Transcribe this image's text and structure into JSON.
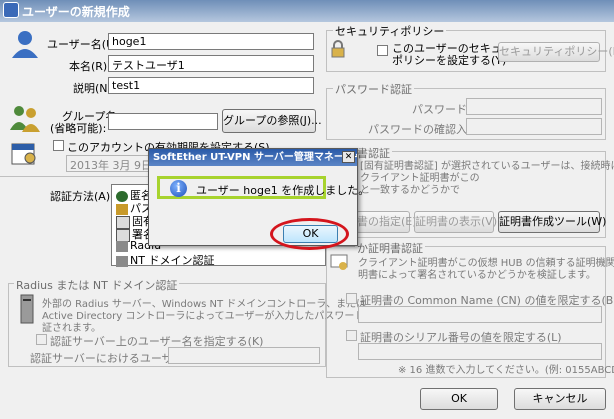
{
  "window": {
    "title": "ユーザーの新規作成"
  },
  "user": {
    "username_label": "ユーザー名(U):",
    "username_value": "hoge1",
    "realname_label": "本名(R):",
    "realname_value": "テストユーザ1",
    "desc_label": "説明(N):",
    "desc_value": "test1"
  },
  "group": {
    "name_label_line1": "グループ名",
    "name_label_line2": "(省略可能):",
    "name_value": "",
    "browse_button": "グループの参照(J)..."
  },
  "expiry": {
    "checkbox_label": "このアカウントの有効期限を設定する(S)",
    "date_value": "2013年 3月 9日"
  },
  "security": {
    "group_label": "セキュリティポリシー",
    "checkbox_line1": "このユーザーのセキュリティ",
    "checkbox_line2": "ポリシーを設定する(Y)",
    "button": "セキュリティポリシー(M)"
  },
  "password": {
    "group_label": "パスワード認証",
    "password_label": "パスワード(P):",
    "confirm_label": "パスワードの確認入力(C):"
  },
  "auth": {
    "label": "認証方法(A):",
    "items": [
      {
        "label": "匿名",
        "icon": "anonymous-icon",
        "color": "#2d6b2d"
      },
      {
        "label": "パスワ",
        "icon": "password-icon",
        "color": "#c89a2a"
      },
      {
        "label": "固有",
        "icon": "cert-icon",
        "color": "#555555"
      },
      {
        "label": "署名",
        "icon": "signed-cert-icon",
        "color": "#555555"
      },
      {
        "label": "Radiu",
        "icon": "radius-icon",
        "color": "#4a4a4a"
      },
      {
        "label": "NT ドメイン認証",
        "icon": "nt-domain-icon",
        "color": "#4a4a4a"
      }
    ]
  },
  "cert_auth": {
    "group_label": "書認証",
    "desc_line1": "[固有証明書認証] が選択されているユーザーは、接続時に SSL",
    "desc_line2": "クライアント証明書がこの",
    "desc_line3": "と一致するかどうかで",
    "btn_specify": "書の指定(E)",
    "btn_show": "証明書の表示(V)",
    "btn_tool": "証明書作成ツール(W)"
  },
  "signed_cert": {
    "group_label": "か証明書認証",
    "desc_line1": "クライアント証明書がこの仮想 HUB の信頼する証明機関の証",
    "desc_line2": "明書によって署名されているかどうかを検証します。",
    "cn_checkbox": "証明書の Common Name (CN) の値を限定する(B)",
    "serial_checkbox": "証明書のシリアル番号の値を限定する(L)",
    "note": "※ 16 進数で入力してください。(例: 0155ABCDEF)"
  },
  "radius": {
    "group_label": "Radius または NT ドメイン認証",
    "desc_line1": "外部の Radius サーバー、Windows NT ドメインコントローラ、または",
    "desc_line2": "Active Directory コントローラによってユーザーが入力したパスワードが検",
    "desc_line3": "証されます。",
    "checkbox_label": "認証サーバー上のユーザー名を指定する(K)",
    "username_label": "認証サーバーにおけるユーザー名(W):"
  },
  "footer": {
    "ok": "OK",
    "cancel": "キャンセル"
  },
  "modal": {
    "title": "SoftEther UT-VPN サーバー管理マネージャ",
    "message": "ユーザー hoge1 を作成しました。",
    "ok": "OK"
  },
  "annotations": {
    "highlight_color": "#a7d32e",
    "circle_color": "#d4151d"
  }
}
